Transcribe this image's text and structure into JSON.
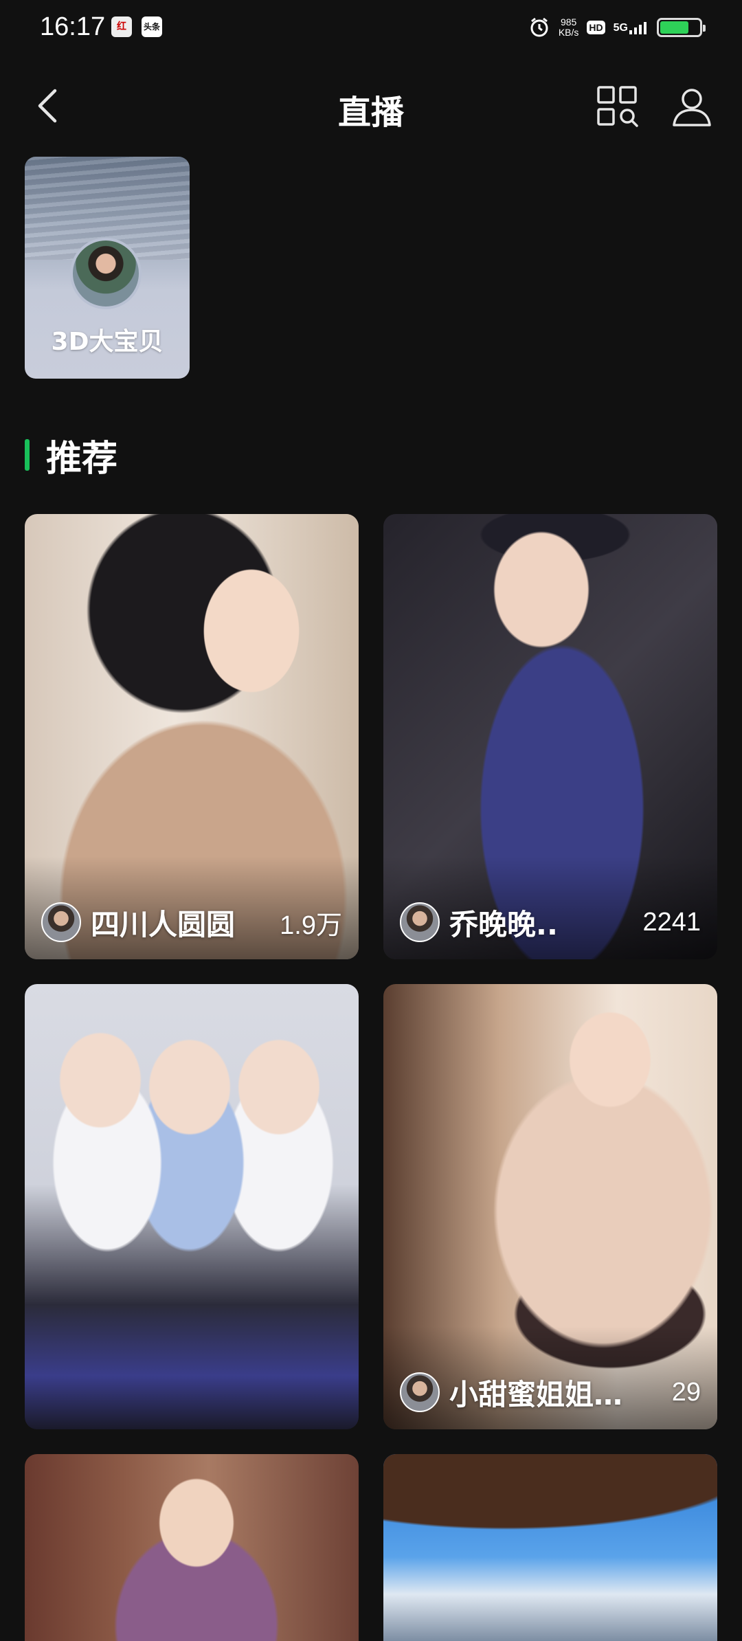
{
  "status_bar": {
    "time": "16:17",
    "app_icons": [
      "红",
      "头条"
    ],
    "net_speed_value": "985",
    "net_speed_unit": "KB/s",
    "hd_label": "HD",
    "network_label": "5G",
    "battery_level": 0.75
  },
  "header": {
    "title": "直播",
    "back_icon": "chevron-left-icon",
    "scan_icon": "qr-search-icon",
    "profile_icon": "person-icon"
  },
  "following": [
    {
      "name": "3D大宝贝"
    }
  ],
  "section": {
    "title": "推荐",
    "accent_color": "#19c05a"
  },
  "streams": [
    {
      "name": "四川人圆圆",
      "viewers": "1.9万"
    },
    {
      "name": "乔晚晚..",
      "viewers": "2241"
    },
    {
      "name": "",
      "viewers": ""
    },
    {
      "name": "小甜蜜姐姐…",
      "viewers": "29"
    },
    {
      "name": "",
      "viewers": ""
    },
    {
      "name": "",
      "viewers": ""
    }
  ]
}
